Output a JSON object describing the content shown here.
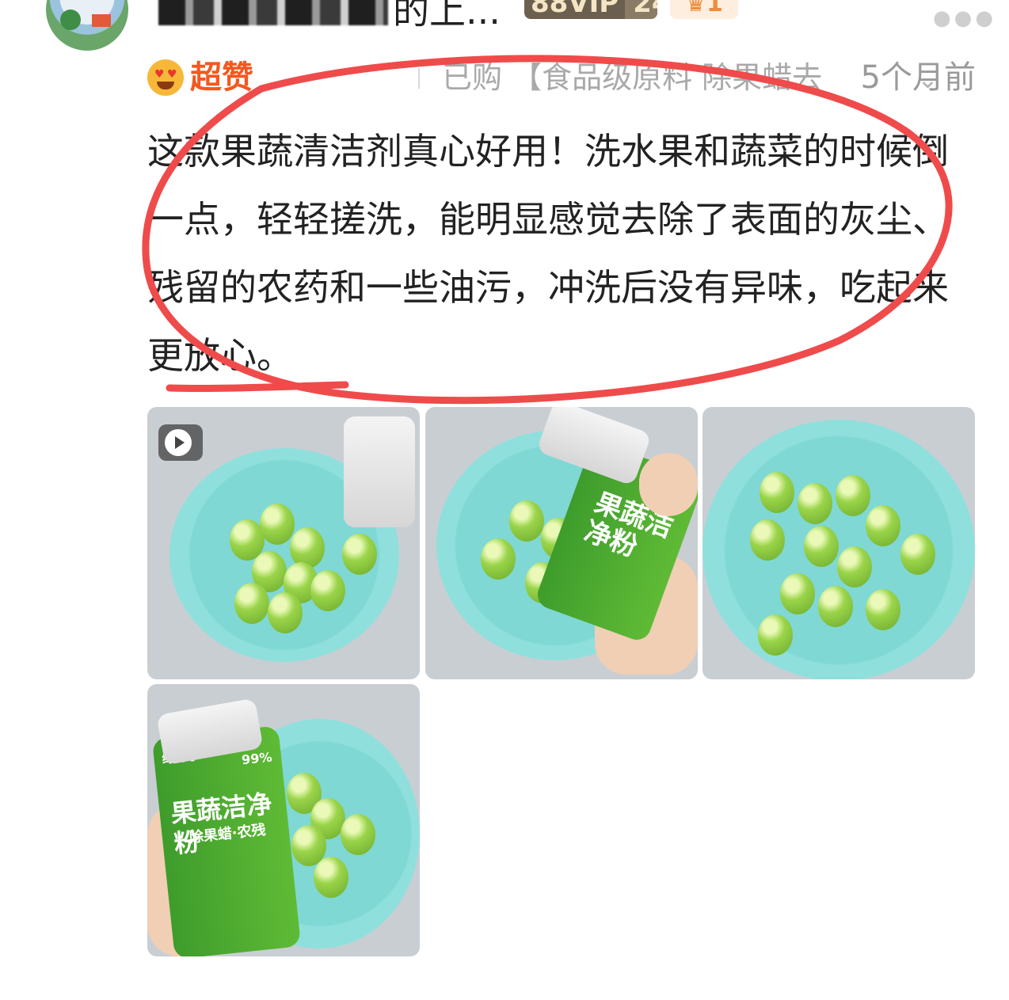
{
  "header": {
    "username_tail": "的上...",
    "vip_badge": [
      "88VIP",
      "24"
    ],
    "level_badge": "1",
    "more_icon": "more-dots-icon"
  },
  "meta": {
    "rating_icon": "heart-eyes-emoji-icon",
    "rating_label": "超赞",
    "purchased_text": "已购 【食品级原料 除果蜡去",
    "chevron_icon": "chevron-down-icon",
    "time_ago": "5个月前"
  },
  "review": {
    "text": "这款果蔬清洁剂真心好用！洗水果和蔬菜的时候倒一点，轻轻搓洗，能明显感觉去除了表面的灰尘、残留的农药和一些油污，冲洗后没有异味，吃起来更放心。"
  },
  "photos": {
    "count": 4,
    "first_is_video": true,
    "bottle_label_line1": "果蔬洁净粉",
    "bottle_label_line2": "除果蜡·农残",
    "bottle_percent": "99%",
    "brand": "绿鼻子"
  },
  "annotation": {
    "color": "#ef4b4b",
    "shape": "hand-drawn-ellipse"
  }
}
